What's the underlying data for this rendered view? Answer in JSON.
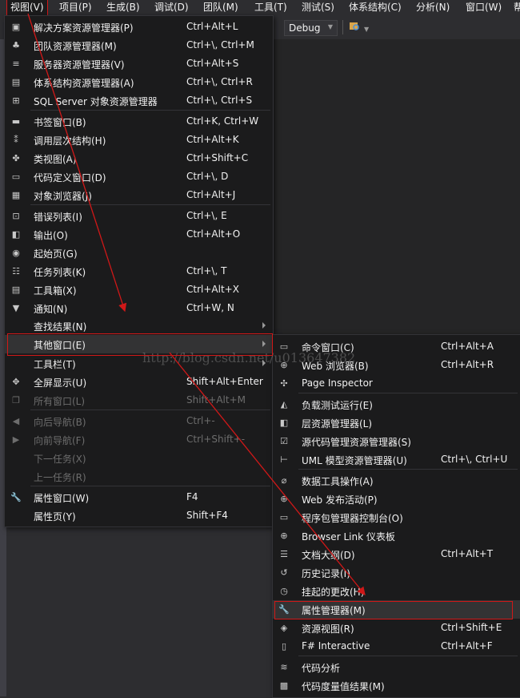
{
  "menubar": [
    "视图(V)",
    "项目(P)",
    "生成(B)",
    "调试(D)",
    "团队(M)",
    "工具(T)",
    "测试(S)",
    "体系结构(C)",
    "分析(N)",
    "窗口(W)",
    "帮"
  ],
  "toolbar": {
    "config": "Debug"
  },
  "view_menu": [
    {
      "label": "解决方案资源管理器(P)",
      "shortcut": "Ctrl+Alt+L",
      "icon": "solution-explorer-icon"
    },
    {
      "label": "团队资源管理器(M)",
      "shortcut": "Ctrl+\\, Ctrl+M",
      "icon": "team-explorer-icon"
    },
    {
      "label": "服务器资源管理器(V)",
      "shortcut": "Ctrl+Alt+S",
      "icon": "server-explorer-icon"
    },
    {
      "label": "体系结构资源管理器(A)",
      "shortcut": "Ctrl+\\, Ctrl+R",
      "icon": "architecture-explorer-icon"
    },
    {
      "label": "SQL Server 对象资源管理器",
      "shortcut": "Ctrl+\\, Ctrl+S",
      "icon": "sql-server-icon"
    },
    {
      "label": "书签窗口(B)",
      "shortcut": "Ctrl+K, Ctrl+W",
      "icon": "bookmark-icon"
    },
    {
      "label": "调用层次结构(H)",
      "shortcut": "Ctrl+Alt+K",
      "icon": "call-hierarchy-icon"
    },
    {
      "label": "类视图(A)",
      "shortcut": "Ctrl+Shift+C",
      "icon": "class-view-icon"
    },
    {
      "label": "代码定义窗口(D)",
      "shortcut": "Ctrl+\\, D",
      "icon": "code-definition-icon"
    },
    {
      "label": "对象浏览器(J)",
      "shortcut": "Ctrl+Alt+J",
      "icon": "object-browser-icon"
    },
    {
      "label": "错误列表(I)",
      "shortcut": "Ctrl+\\, E",
      "icon": "error-list-icon"
    },
    {
      "label": "输出(O)",
      "shortcut": "Ctrl+Alt+O",
      "icon": "output-icon"
    },
    {
      "label": "起始页(G)",
      "shortcut": "",
      "icon": "start-page-icon"
    },
    {
      "label": "任务列表(K)",
      "shortcut": "Ctrl+\\, T",
      "icon": "task-list-icon"
    },
    {
      "label": "工具箱(X)",
      "shortcut": "Ctrl+Alt+X",
      "icon": "toolbox-icon"
    },
    {
      "label": "通知(N)",
      "shortcut": "Ctrl+W, N",
      "icon": "notification-icon"
    },
    {
      "label": "查找结果(N)",
      "shortcut": "",
      "icon": ""
    },
    {
      "label": "其他窗口(E)",
      "shortcut": "",
      "icon": ""
    },
    {
      "label": "工具栏(T)",
      "shortcut": "",
      "icon": ""
    },
    {
      "label": "全屏显示(U)",
      "shortcut": "Shift+Alt+Enter",
      "icon": "fullscreen-icon"
    },
    {
      "label": "所有窗口(L)",
      "shortcut": "Shift+Alt+M",
      "icon": "all-windows-icon"
    },
    {
      "label": "向后导航(B)",
      "shortcut": "Ctrl+-",
      "icon": "navigate-back-icon"
    },
    {
      "label": "向前导航(F)",
      "shortcut": "Ctrl+Shift+-",
      "icon": "navigate-forward-icon"
    },
    {
      "label": "下一任务(X)",
      "shortcut": "",
      "icon": ""
    },
    {
      "label": "上一任务(R)",
      "shortcut": "",
      "icon": ""
    },
    {
      "label": "属性窗口(W)",
      "shortcut": "F4",
      "icon": "wrench-icon"
    },
    {
      "label": "属性页(Y)",
      "shortcut": "Shift+F4",
      "icon": ""
    }
  ],
  "other_windows_menu": [
    {
      "label": "命令窗口(C)",
      "shortcut": "Ctrl+Alt+A",
      "icon": "command-window-icon"
    },
    {
      "label": "Web 浏览器(B)",
      "shortcut": "Ctrl+Alt+R",
      "icon": "globe-icon"
    },
    {
      "label": "Page Inspector",
      "shortcut": "",
      "icon": "page-inspector-icon"
    },
    {
      "label": "负载测试运行(E)",
      "shortcut": "",
      "icon": "load-test-icon"
    },
    {
      "label": "层资源管理器(L)",
      "shortcut": "",
      "icon": "layer-explorer-icon"
    },
    {
      "label": "源代码管理资源管理器(S)",
      "shortcut": "",
      "icon": "source-control-icon"
    },
    {
      "label": "UML 模型资源管理器(U)",
      "shortcut": "Ctrl+\\, Ctrl+U",
      "icon": "uml-model-icon"
    },
    {
      "label": "数据工具操作(A)",
      "shortcut": "",
      "icon": "data-tools-icon"
    },
    {
      "label": "Web 发布活动(P)",
      "shortcut": "",
      "icon": "web-publish-icon"
    },
    {
      "label": "程序包管理器控制台(O)",
      "shortcut": "",
      "icon": "package-console-icon"
    },
    {
      "label": "Browser Link 仪表板",
      "shortcut": "",
      "icon": "browser-link-icon"
    },
    {
      "label": "文档大纲(D)",
      "shortcut": "Ctrl+Alt+T",
      "icon": "document-outline-icon"
    },
    {
      "label": "历史记录(I)",
      "shortcut": "",
      "icon": "history-icon"
    },
    {
      "label": "挂起的更改(H)",
      "shortcut": "",
      "icon": "pending-changes-icon"
    },
    {
      "label": "属性管理器(M)",
      "shortcut": "",
      "icon": "property-manager-icon"
    },
    {
      "label": "资源视图(R)",
      "shortcut": "Ctrl+Shift+E",
      "icon": "resource-view-icon"
    },
    {
      "label": "F# Interactive",
      "shortcut": "Ctrl+Alt+F",
      "icon": "fsharp-icon"
    },
    {
      "label": "代码分析",
      "shortcut": "",
      "icon": "code-analysis-icon"
    },
    {
      "label": "代码度量值结果(M)",
      "shortcut": "",
      "icon": "code-metrics-icon"
    }
  ],
  "watermark": "http://blog.csdn.net/u013647382"
}
